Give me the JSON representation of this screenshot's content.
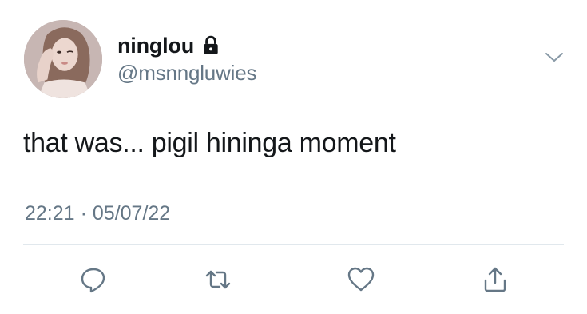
{
  "tweet": {
    "author": {
      "display_name": "ninglou",
      "handle": "@msnngluwies",
      "protected_icon": "lock-icon",
      "avatar": "profile-photo"
    },
    "menu_icon": "chevron-down-icon",
    "text": "that was... pigil hininga moment",
    "time": "22:21",
    "separator": "·",
    "date": "05/07/22"
  },
  "actions": [
    {
      "name": "reply",
      "icon": "reply-icon"
    },
    {
      "name": "retweet",
      "icon": "retweet-icon"
    },
    {
      "name": "like",
      "icon": "heart-icon"
    },
    {
      "name": "share",
      "icon": "share-icon"
    }
  ],
  "colors": {
    "text_primary": "#14171a",
    "text_secondary": "#657786",
    "divider": "#e1e8ed",
    "icon": "#657786"
  }
}
